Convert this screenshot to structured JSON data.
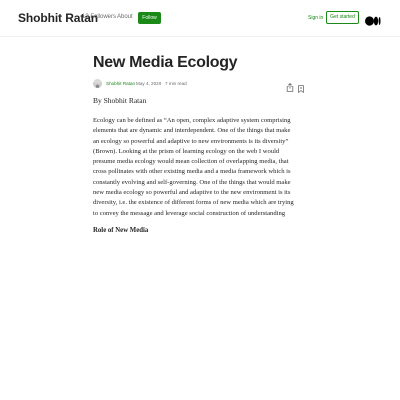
{
  "header": {
    "brand": "Shobhit Ratan",
    "followers": "13 Followers",
    "about": "About",
    "follow": "Follow",
    "sign_in": "Sign in",
    "get_started": "Get started",
    "logo_icon": "medium-logo-icon",
    "accent_color": "#1a8917"
  },
  "article": {
    "title": "New Media Ecology",
    "author": "Shobhit Ratan",
    "date": "May 4, 2020",
    "separator": "·",
    "read_time": "7 min read",
    "byline": "By Shobhit Ratan",
    "body_lines": [
      "Ecology can be defined as “An open, complex adaptive system comprising",
      "elements that are dynamic and interdependent. One of the things that make",
      "an ecology so powerful and adaptive to new environments is its diversity”",
      "(Brown). Looking at the prism of learning ecology on the web I would",
      "presume media ecology would mean collection of overlapping media, that",
      "cross pollinates with other existing media and a media framework which is",
      "constantly evolving and self-governing. One of the things that would make",
      "new media ecology so powerful and adaptive to the new environment is its",
      "diversity, i.e. the existence of different forms of new media which are trying",
      "to convey the message and leverage social construction of understanding"
    ],
    "subheading": "Role of New Media"
  },
  "icons": {
    "share": "share-icon",
    "bookmark": "bookmark-icon",
    "avatar": "avatar"
  }
}
